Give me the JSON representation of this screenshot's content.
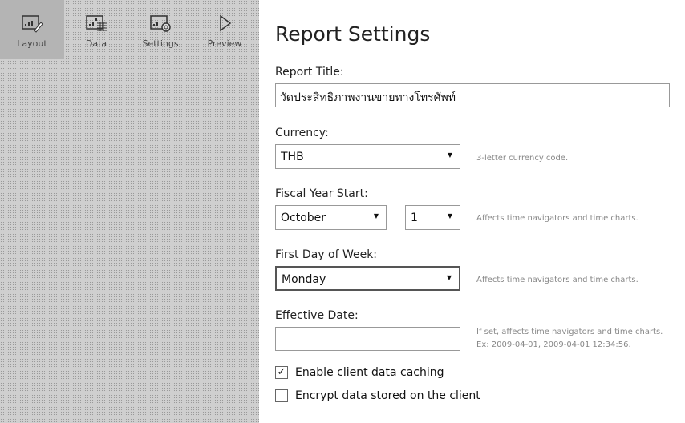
{
  "tabs": [
    {
      "label": "Layout",
      "icon": "layout-chart-pencil-icon"
    },
    {
      "label": "Data",
      "icon": "data-chart-table-icon"
    },
    {
      "label": "Settings",
      "icon": "settings-chart-gear-icon"
    },
    {
      "label": "Preview",
      "icon": "play-icon"
    }
  ],
  "selected_tab": "Layout",
  "heading": "Report Settings",
  "report_title": {
    "label": "Report Title:",
    "value": "วัดประสิทธิภาพงานขายทางโทรศัพท์"
  },
  "currency": {
    "label": "Currency:",
    "value": "THB",
    "hint": "3-letter currency code."
  },
  "fiscal": {
    "label": "Fiscal Year Start:",
    "month": "October",
    "day": "1",
    "hint": "Affects time navigators and time charts."
  },
  "week": {
    "label": "First Day of Week:",
    "value": "Monday",
    "hint": "Affects time navigators and time charts."
  },
  "effective": {
    "label": "Effective Date:",
    "value": "",
    "hint1": "If set, affects time navigators and time charts.",
    "hint2": "Ex: 2009-04-01, 2009-04-01 12:34:56."
  },
  "caching": {
    "label": "Enable client data caching",
    "checked": true,
    "mark": "✓"
  },
  "encrypt": {
    "label": "Encrypt data stored on the client",
    "checked": false
  }
}
